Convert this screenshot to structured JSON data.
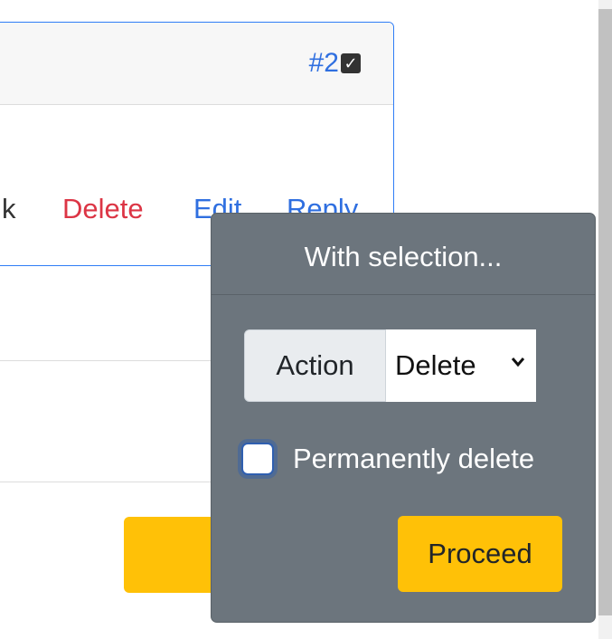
{
  "comment_card": {
    "number": "#2",
    "checkbox_checked": true,
    "actions": {
      "partial": "k",
      "delete": "Delete",
      "edit": "Edit",
      "reply": "Reply"
    }
  },
  "popover": {
    "title": "With selection...",
    "action_label": "Action",
    "action_selected": "Delete",
    "permanently_delete_label": "Permanently delete",
    "permanently_delete_checked": false,
    "proceed_label": "Proceed"
  },
  "colors": {
    "accent_blue": "#2f7df6",
    "danger": "#dc3545",
    "warning": "#ffc107",
    "popover_bg": "#6c757d"
  },
  "icons": {
    "card_checkbox": "checked-checkbox-icon",
    "select_chevron": "chevron-down-icon"
  }
}
